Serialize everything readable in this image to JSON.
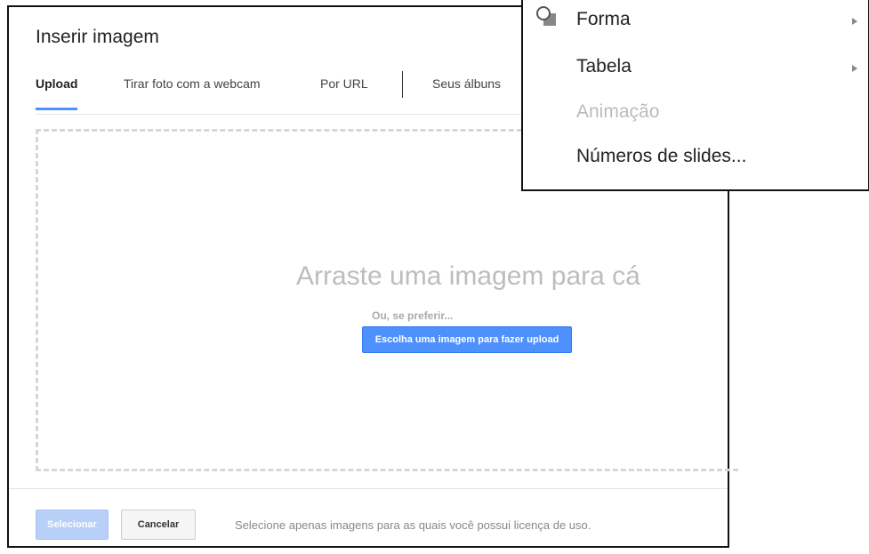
{
  "dialog": {
    "title": "Inserir imagem",
    "tabs": [
      {
        "label": "Upload",
        "active": true
      },
      {
        "label": "Tirar foto com a webcam",
        "active": false
      },
      {
        "label": "Por URL",
        "active": false
      },
      {
        "label": "Seus álbuns",
        "active": false
      }
    ],
    "dropzone": {
      "headline": "Arraste uma imagem para cá",
      "or_text": "Ou, se preferir...",
      "upload_button": "Escolha uma imagem para fazer upload"
    },
    "footer": {
      "select_button": "Selecionar",
      "cancel_button": "Cancelar",
      "note": "Selecione apenas imagens para as quais você possui licença de uso."
    }
  },
  "menu": {
    "items": [
      {
        "label": "Forma",
        "submenu": true,
        "disabled": false,
        "icon": "shape-icon"
      },
      {
        "label": "Tabela",
        "submenu": true,
        "disabled": false
      },
      {
        "label": "Animação",
        "submenu": false,
        "disabled": true
      },
      {
        "label": "Números de slides...",
        "submenu": false,
        "disabled": false
      }
    ]
  },
  "colors": {
    "accent": "#4d90fe",
    "accent_disabled": "#b8cff7",
    "drop_text": "#bdbdbd"
  }
}
